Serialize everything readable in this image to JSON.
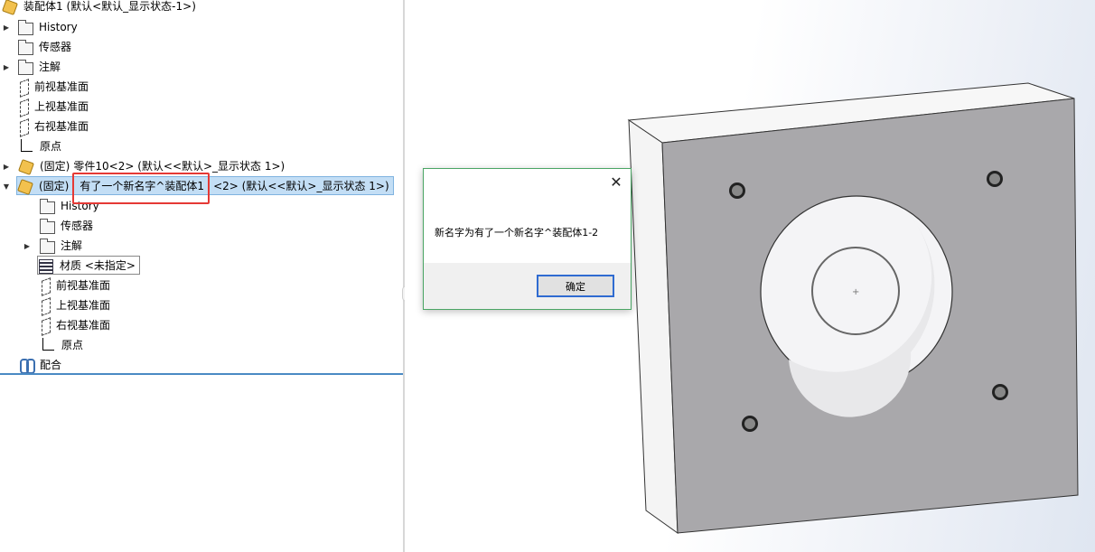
{
  "tree": {
    "root": "装配体1  (默认<默认_显示状态-1>)",
    "items": [
      "History",
      "传感器",
      "注解",
      "前视基准面",
      "上视基准面",
      "右视基准面",
      "原点"
    ],
    "part1": {
      "prefix": "(固定)",
      "name": "零件10<2> (默认<<默认>_显示状态 1>)"
    },
    "part2": {
      "prefix": "(固定)",
      "name_highlight": "有了一个新名字^装配体1",
      "name_rest": "<2> (默认<<默认>_显示状态 1>)"
    },
    "children": [
      "History",
      "传感器",
      "注解",
      "材质 <未指定>",
      "前视基准面",
      "上视基准面",
      "右视基准面",
      "原点"
    ],
    "mates": "配合"
  },
  "dialog": {
    "message": "新名字为有了一个新名字^装配体1-2",
    "ok_label": "确定",
    "close_glyph": "✕"
  },
  "colors": {
    "selection": "#c3def5",
    "highlight_border": "#e53935",
    "dialog_border": "#4aa564",
    "separator": "#4a8ac4"
  }
}
